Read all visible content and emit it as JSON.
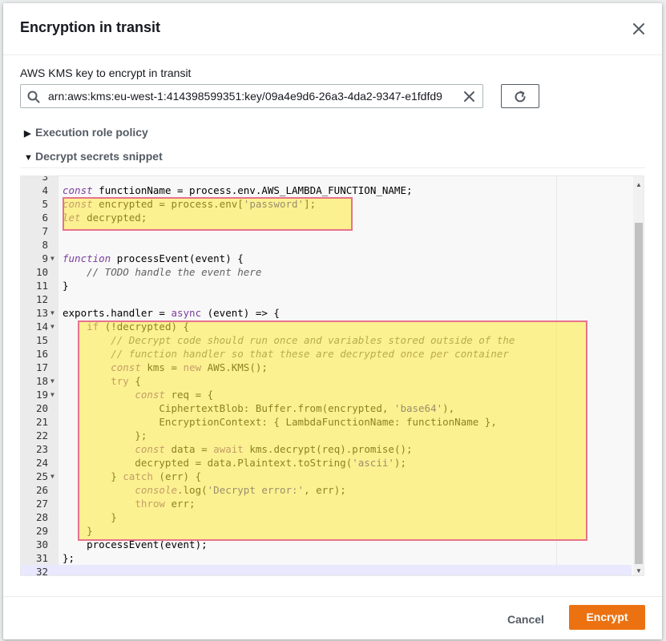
{
  "modal": {
    "title": "Encryption in transit",
    "close_icon": "close-icon"
  },
  "kms": {
    "label": "AWS KMS key to encrypt in transit",
    "value": "arn:aws:kms:eu-west-1:414398599351:key/09a4e9d6-26a3-4da2-9347-e1fdfd9",
    "search_icon": "search-icon",
    "clear_icon": "clear-icon",
    "refresh_icon": "refresh-icon"
  },
  "sections": {
    "execution_role": {
      "label": "Execution role policy",
      "expanded": false
    },
    "decrypt_snippet": {
      "label": "Decrypt secrets snippet",
      "expanded": true
    }
  },
  "editor": {
    "lines": [
      {
        "n": "3",
        "fold": false,
        "text": ""
      },
      {
        "n": "4",
        "fold": false,
        "text": "const functionName = process.env.AWS_LAMBDA_FUNCTION_NAME;"
      },
      {
        "n": "5",
        "fold": false,
        "text": "const encrypted = process.env['password'];"
      },
      {
        "n": "6",
        "fold": false,
        "text": "let decrypted;"
      },
      {
        "n": "7",
        "fold": false,
        "text": ""
      },
      {
        "n": "8",
        "fold": false,
        "text": ""
      },
      {
        "n": "9",
        "fold": true,
        "text": "function processEvent(event) {"
      },
      {
        "n": "10",
        "fold": false,
        "text": "    // TODO handle the event here"
      },
      {
        "n": "11",
        "fold": false,
        "text": "}"
      },
      {
        "n": "12",
        "fold": false,
        "text": ""
      },
      {
        "n": "13",
        "fold": true,
        "text": "exports.handler = async (event) => {"
      },
      {
        "n": "14",
        "fold": true,
        "text": "    if (!decrypted) {"
      },
      {
        "n": "15",
        "fold": false,
        "text": "        // Decrypt code should run once and variables stored outside of the"
      },
      {
        "n": "16",
        "fold": false,
        "text": "        // function handler so that these are decrypted once per container"
      },
      {
        "n": "17",
        "fold": false,
        "text": "        const kms = new AWS.KMS();"
      },
      {
        "n": "18",
        "fold": true,
        "text": "        try {"
      },
      {
        "n": "19",
        "fold": true,
        "text": "            const req = {"
      },
      {
        "n": "20",
        "fold": false,
        "text": "                CiphertextBlob: Buffer.from(encrypted, 'base64'),"
      },
      {
        "n": "21",
        "fold": false,
        "text": "                EncryptionContext: { LambdaFunctionName: functionName },"
      },
      {
        "n": "22",
        "fold": false,
        "text": "            };"
      },
      {
        "n": "23",
        "fold": false,
        "text": "            const data = await kms.decrypt(req).promise();"
      },
      {
        "n": "24",
        "fold": false,
        "text": "            decrypted = data.Plaintext.toString('ascii');"
      },
      {
        "n": "25",
        "fold": true,
        "text": "        } catch (err) {"
      },
      {
        "n": "26",
        "fold": false,
        "text": "            console.log('Decrypt error:', err);"
      },
      {
        "n": "27",
        "fold": false,
        "text": "            throw err;"
      },
      {
        "n": "28",
        "fold": false,
        "text": "        }"
      },
      {
        "n": "29",
        "fold": false,
        "text": "    }"
      },
      {
        "n": "30",
        "fold": false,
        "text": "    processEvent(event);"
      },
      {
        "n": "31",
        "fold": false,
        "text": "};"
      },
      {
        "n": "32",
        "fold": false,
        "text": ""
      }
    ],
    "highlight_color": "#fff176",
    "highlight_border": "#e8728c"
  },
  "footer": {
    "cancel_label": "Cancel",
    "encrypt_label": "Encrypt"
  },
  "colors": {
    "primary": "#ec7211",
    "text": "#16191f",
    "secondary_text": "#545b64"
  }
}
